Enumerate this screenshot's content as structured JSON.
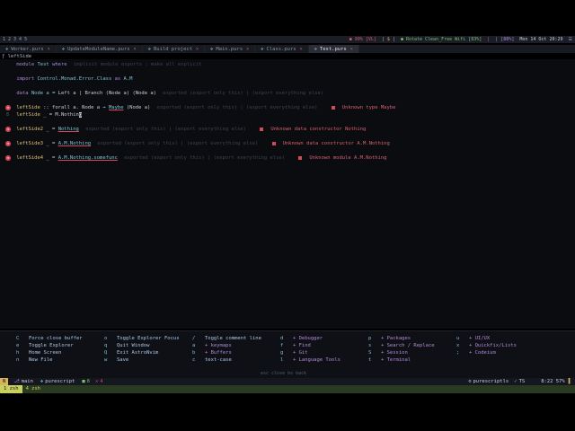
{
  "tmux": {
    "windows": "1 2 3 4 5",
    "seg_red1": "● 99% [VL]",
    "seg_yellow": "| $ |",
    "seg_green": "● Rotate Clean_Free Wifi [83%]",
    "seg_red2": "|",
    "seg_purple": "| [88%]",
    "clock": "Mon 14 Oct 20:29"
  },
  "tabs": [
    {
      "label": "Worker.purs"
    },
    {
      "label": "UpdateModuleName.purs"
    },
    {
      "label": "Build project"
    },
    {
      "label": "Main.purs"
    },
    {
      "label": "Class.purs"
    },
    {
      "label": "Test.purs"
    }
  ],
  "breadcrumb": "leftSide",
  "code": {
    "l1": {
      "kw": "module",
      "name": "Test",
      "kw2": "where",
      "hint": "implicit module exports : make all explicit"
    },
    "l2": {
      "kw": "import",
      "name": "Control.Monad.Error.Class",
      "kw2": "as",
      "alias": "A.M"
    },
    "l3": {
      "kw": "data",
      "name": "Node a",
      "rest": "= Left a | Branch (Node a) (Node a)",
      "hint": "exported (export only this) | (export everything else)"
    },
    "l4": {
      "fn": "leftSide",
      "rest1": ":: forall a. Node a →",
      "ty": "Maybe",
      "rest2": "(Node a)",
      "hint": "exported (export only this) | (export everything else)",
      "diag": "Unknown type Maybe"
    },
    "l5": {
      "gutter": "8",
      "fn": "leftSide",
      "rest": "_ = M.Nothin",
      "cursor": "g"
    },
    "l6": {
      "fn": "leftSide2",
      "rest": "_ =",
      "val": "Nothing",
      "hint": "exported (export only this) | (export everything else)",
      "diag": "Unknown data constructor Nothing"
    },
    "l7": {
      "fn": "leftSide3",
      "rest": "_ =",
      "val": "A.M.Nothing",
      "hint": "exported (export only this) | (export everything else)",
      "diag": "Unknown data constructor A.M.Nothing"
    },
    "l8": {
      "fn": "leftSide4",
      "rest": "_ =",
      "val": "A.M.Nothing.somefunc",
      "hint": "exported (export only this) | (export everything else)",
      "diag": "Unknown module A.M.Nothing"
    }
  },
  "whichkey": {
    "col1": [
      {
        "k": "C",
        "d": "Force close buffer"
      },
      {
        "k": "e",
        "d": "Toggle Explorer"
      },
      {
        "k": "h",
        "d": "Home Screen"
      },
      {
        "k": "n",
        "d": "New File"
      }
    ],
    "col2": [
      {
        "k": "o",
        "d": "Toggle Explorer Focus"
      },
      {
        "k": "q",
        "d": "Quit Window"
      },
      {
        "k": "Q",
        "d": "Exit AstroNvim"
      },
      {
        "k": "w",
        "d": "Save"
      }
    ],
    "col3": [
      {
        "k": "/",
        "d": "Toggle comment line"
      },
      {
        "k": "a",
        "d": "+ keymaps"
      },
      {
        "k": "b",
        "d": "+ Buffers"
      },
      {
        "k": "c",
        "d": "text-case"
      }
    ],
    "col4": [
      {
        "k": "d",
        "d": "+ Debugger"
      },
      {
        "k": "f",
        "d": "+ Find"
      },
      {
        "k": "g",
        "d": "+ Git"
      },
      {
        "k": "l",
        "d": "+ Language Tools"
      }
    ],
    "col5": [
      {
        "k": "p",
        "d": "+ Packages"
      },
      {
        "k": "s",
        "d": "+ Search / Replace"
      },
      {
        "k": "S",
        "d": "+ Session"
      },
      {
        "k": "t",
        "d": "+ Terminal"
      }
    ],
    "col6": [
      {
        "k": "u",
        "d": "+ UI/UX"
      },
      {
        "k": "x",
        "d": "+ Quickfix/Lists"
      },
      {
        "k": ";",
        "d": "+ Codeium"
      }
    ],
    "footer": "esc close   bs back"
  },
  "status": {
    "mode": "N",
    "branch": "main",
    "lang": "purescript",
    "added": "8",
    "errors": "4",
    "lsp": "purescriptls",
    "ts": "TS",
    "pos": "8:22 57%"
  },
  "tmux_bottom": {
    "w1": "1 zsh",
    "w2": "4 zsh"
  },
  "colors": {
    "error": "#d04a5a",
    "mode": "#d8b45a",
    "accent": "#7cc0d8"
  }
}
